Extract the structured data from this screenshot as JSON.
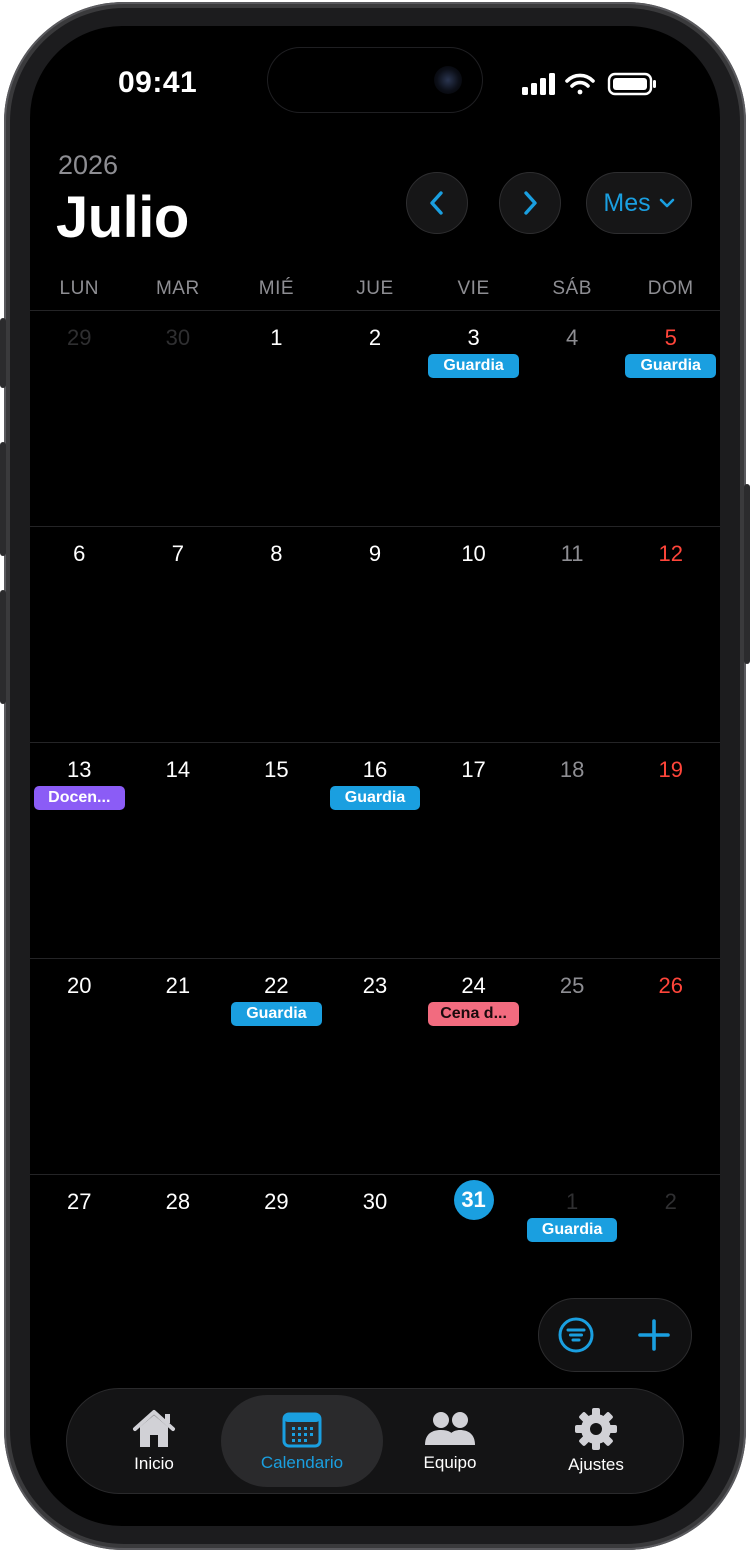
{
  "status_bar": {
    "time": "09:41"
  },
  "header": {
    "year": "2026",
    "month": "Julio",
    "view_label": "Mes"
  },
  "weekdays": [
    "LUN",
    "MAR",
    "MIÉ",
    "JUE",
    "VIE",
    "SÁB",
    "DOM"
  ],
  "colors": {
    "accent": "#1a9fe0",
    "guardia": "#1a9fe0",
    "docencia": "#8b5cf6",
    "cena": "#f26b7f",
    "sunday": "#ff453a"
  },
  "weeks": [
    [
      {
        "d": "29",
        "muted": true
      },
      {
        "d": "30",
        "muted": true
      },
      {
        "d": "1"
      },
      {
        "d": "2"
      },
      {
        "d": "3",
        "event": "Guardia",
        "event_type": "guardia"
      },
      {
        "d": "4"
      },
      {
        "d": "5",
        "event": "Guardia",
        "event_type": "guardia"
      }
    ],
    [
      {
        "d": "6"
      },
      {
        "d": "7"
      },
      {
        "d": "8"
      },
      {
        "d": "9"
      },
      {
        "d": "10"
      },
      {
        "d": "11"
      },
      {
        "d": "12"
      }
    ],
    [
      {
        "d": "13",
        "event": "Docen...",
        "event_type": "docencia"
      },
      {
        "d": "14"
      },
      {
        "d": "15"
      },
      {
        "d": "16",
        "event": "Guardia",
        "event_type": "guardia"
      },
      {
        "d": "17"
      },
      {
        "d": "18"
      },
      {
        "d": "19"
      }
    ],
    [
      {
        "d": "20"
      },
      {
        "d": "21"
      },
      {
        "d": "22",
        "event": "Guardia",
        "event_type": "guardia"
      },
      {
        "d": "23"
      },
      {
        "d": "24",
        "event": "Cena d...",
        "event_type": "cena"
      },
      {
        "d": "25"
      },
      {
        "d": "26"
      }
    ],
    [
      {
        "d": "27"
      },
      {
        "d": "28"
      },
      {
        "d": "29"
      },
      {
        "d": "30"
      },
      {
        "d": "31",
        "today": true
      },
      {
        "d": "1",
        "muted": true,
        "event": "Guardia",
        "event_type": "guardia"
      },
      {
        "d": "2",
        "muted": true
      }
    ]
  ],
  "tabs": [
    {
      "label": "Inicio",
      "icon": "house-icon"
    },
    {
      "label": "Calendario",
      "icon": "calendar-icon",
      "active": true
    },
    {
      "label": "Equipo",
      "icon": "people-icon"
    },
    {
      "label": "Ajustes",
      "icon": "gear-icon"
    }
  ]
}
